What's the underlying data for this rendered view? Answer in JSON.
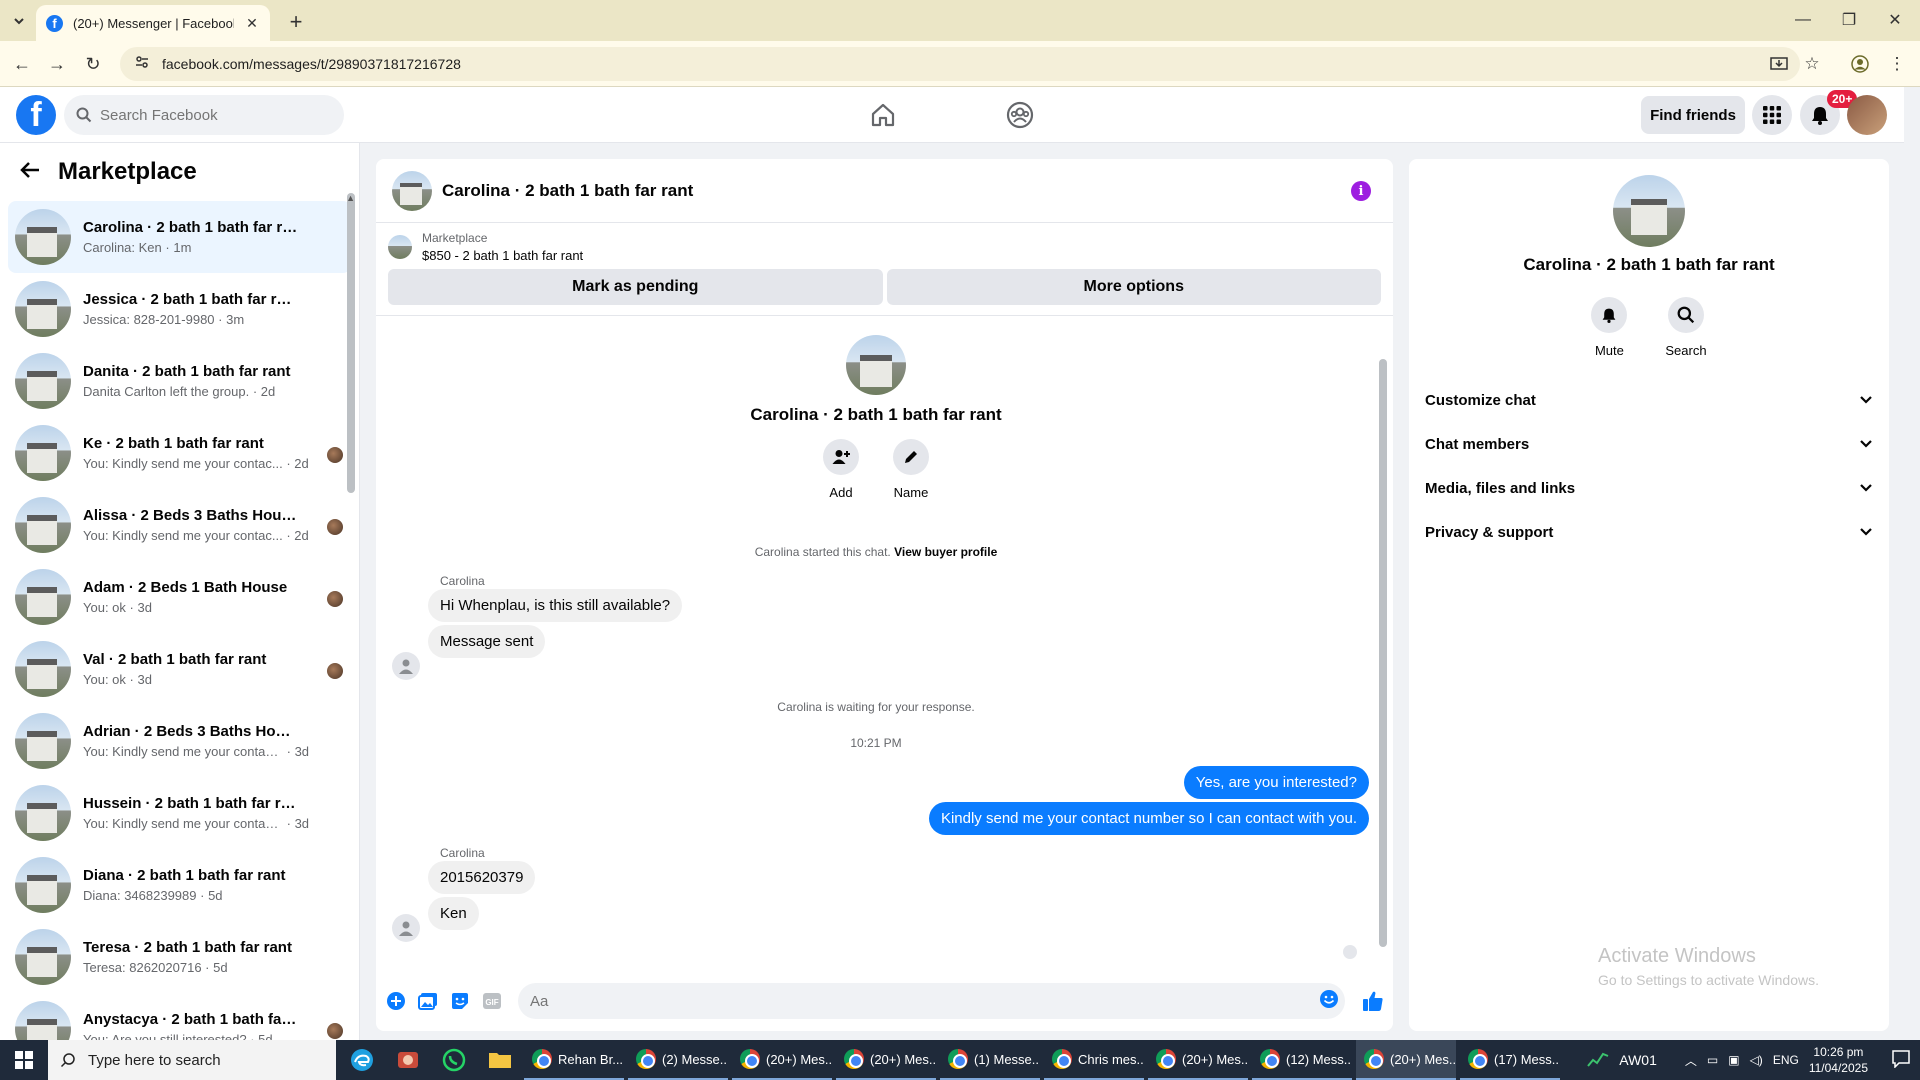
{
  "browser": {
    "tab_title": "(20+) Messenger | Facebook",
    "url": "facebook.com/messages/t/29890371817216728"
  },
  "header": {
    "search_placeholder": "Search Facebook",
    "find_friends": "Find friends",
    "notification_badge": "20+"
  },
  "left_pane": {
    "title": "Marketplace",
    "conversations": [
      {
        "name": "Carolina · 2 bath 1 bath far rant",
        "preview": "Carolina: Ken",
        "time": "1m",
        "active": true
      },
      {
        "name": "Jessica · 2 bath 1 bath far rant",
        "preview": "Jessica: 828-201-9980",
        "time": "3m"
      },
      {
        "name": "Danita · 2 bath 1 bath far rant",
        "preview": "Danita Carlton left the group.",
        "time": "2d"
      },
      {
        "name": "Ke · 2 bath 1 bath far rant",
        "preview": "You: Kindly send me your contac...",
        "time": "2d"
      },
      {
        "name": "Alissa · 2 Beds 3 Baths House",
        "preview": "You: Kindly send me your contac...",
        "time": "2d"
      },
      {
        "name": "Adam · 2 Beds 1 Bath House",
        "preview": "You: ok",
        "time": "3d"
      },
      {
        "name": "Val · 2 bath 1 bath far rant",
        "preview": "You: ok",
        "time": "3d"
      },
      {
        "name": "Adrian · 2 Beds 3 Baths House",
        "preview": "You: Kindly send me your contact n...",
        "time": "3d"
      },
      {
        "name": "Hussein · 2 bath 1 bath far rant",
        "preview": "You: Kindly send me your contact n...",
        "time": "3d"
      },
      {
        "name": "Diana · 2 bath 1 bath far rant",
        "preview": "Diana: 3468239989",
        "time": "5d"
      },
      {
        "name": "Teresa · 2 bath 1 bath far rant",
        "preview": "Teresa: 8262020716",
        "time": "5d"
      },
      {
        "name": "Anystacya · 2 bath 1 bath far r...",
        "preview": "You: Are you still interested?",
        "time": "5d"
      }
    ]
  },
  "chat": {
    "title": "Carolina · 2 bath 1 bath far rant",
    "marketplace_label": "Marketplace",
    "listing": "$850 - 2 bath 1 bath far rant",
    "mark_pending": "Mark as pending",
    "more_options": "More options",
    "intro_name": "Carolina · 2 bath 1 bath far rant",
    "add_label": "Add",
    "name_label": "Name",
    "started_text": "Carolina started this chat.",
    "view_buyer": "View buyer profile",
    "sender_name": "Carolina",
    "msg1": "Hi Whenplau, is this still available?",
    "msg2": "Message sent",
    "waiting_text": "Carolina is waiting for your response.",
    "timestamp": "10:21 PM",
    "out1": "Yes, are you interested?",
    "out2": "Kindly send me your contact number so I can contact with you.",
    "sender_name2": "Carolina",
    "msg3": "2015620379",
    "msg4": "Ken",
    "composer_placeholder": "Aa"
  },
  "right_pane": {
    "name": "Carolina · 2 bath 1 bath far rant",
    "mute": "Mute",
    "search": "Search",
    "sections": [
      "Customize chat",
      "Chat members",
      "Media, files and links",
      "Privacy & support"
    ],
    "watermark_title": "Activate Windows",
    "watermark_sub": "Go to Settings to activate Windows."
  },
  "taskbar": {
    "search_placeholder": "Type here to search",
    "tasks": [
      "Rehan Br...",
      "(2) Messe...",
      "(20+) Mes...",
      "(20+) Mes...",
      "(1) Messe...",
      "Chris mes...",
      "(20+) Mes...",
      "(12) Mess...",
      "(20+) Mes...",
      "(17) Mess..."
    ],
    "ticker": "AW01",
    "lang": "ENG",
    "time": "10:26 pm",
    "date": "11/04/2025"
  }
}
